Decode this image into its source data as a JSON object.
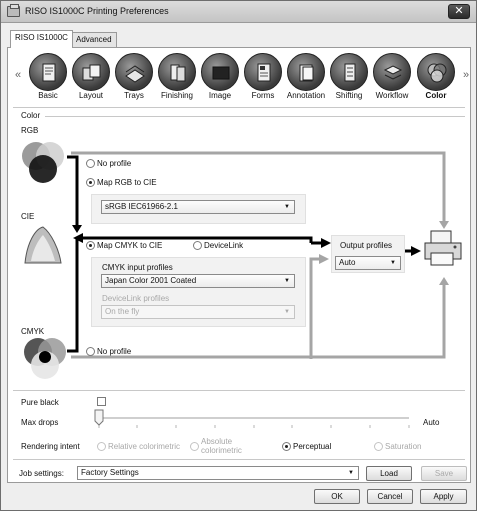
{
  "window": {
    "title": "RISO IS1000C Printing Preferences",
    "close_glyph": "✕"
  },
  "tabs": [
    {
      "label": "RISO IS1000C",
      "active": true
    },
    {
      "label": "Advanced",
      "active": false
    }
  ],
  "nav": {
    "left_arrow": "«",
    "right_arrow": "»",
    "items": [
      {
        "label": "Basic",
        "icon": "document-icon"
      },
      {
        "label": "Layout",
        "icon": "layout-icon"
      },
      {
        "label": "Trays",
        "icon": "trays-icon"
      },
      {
        "label": "Finishing",
        "icon": "finishing-icon"
      },
      {
        "label": "Image",
        "icon": "image-icon"
      },
      {
        "label": "Forms",
        "icon": "forms-icon"
      },
      {
        "label": "Annotation",
        "icon": "annotation-icon"
      },
      {
        "label": "Shifting",
        "icon": "shifting-icon"
      },
      {
        "label": "Workflow",
        "icon": "workflow-icon"
      },
      {
        "label": "Color",
        "icon": "color-icon",
        "active": true
      }
    ]
  },
  "color_section": {
    "heading": "Color",
    "rgb_label": "RGB",
    "cie_label": "CIE",
    "cmyk_label": "CMYK",
    "rgb_no_profile": "No profile",
    "map_rgb_to_cie": "Map RGB to CIE",
    "rgb_profile_value": "sRGB IEC61966-2.1",
    "map_cmyk_to_cie": "Map CMYK to CIE",
    "devicelink": "DeviceLink",
    "cmyk_input_profiles_label": "CMYK input profiles",
    "cmyk_input_profiles_value": "Japan Color 2001 Coated",
    "devicelink_profiles_label": "DeviceLink profiles",
    "devicelink_profiles_value": "On the fly",
    "cmyk_no_profile": "No profile",
    "output_profiles_label": "Output profiles",
    "output_profiles_value": "Auto",
    "selected_rgb_mode": "Map RGB to CIE",
    "selected_cmyk_mode": "Map CMYK to CIE"
  },
  "settings": {
    "pure_black_label": "Pure black",
    "pure_black_checked": false,
    "max_drops_label": "Max drops",
    "max_drops_value": "Auto",
    "rendering_intent_label": "Rendering intent",
    "rendering_options": [
      "Relative colorimetric",
      "Absolute colorimetric",
      "Perceptual",
      "Saturation"
    ],
    "rendering_selected": "Perceptual"
  },
  "job": {
    "label": "Job settings:",
    "value": "Factory Settings",
    "load": "Load",
    "save": "Save"
  },
  "footer": {
    "ok": "OK",
    "cancel": "Cancel",
    "apply": "Apply"
  },
  "colors": {
    "flow_arrow_black": "#000000",
    "flow_arrow_gray": "#a5a5a5",
    "panel_bg": "#ffffff",
    "window_bg": "#eeeeee"
  }
}
